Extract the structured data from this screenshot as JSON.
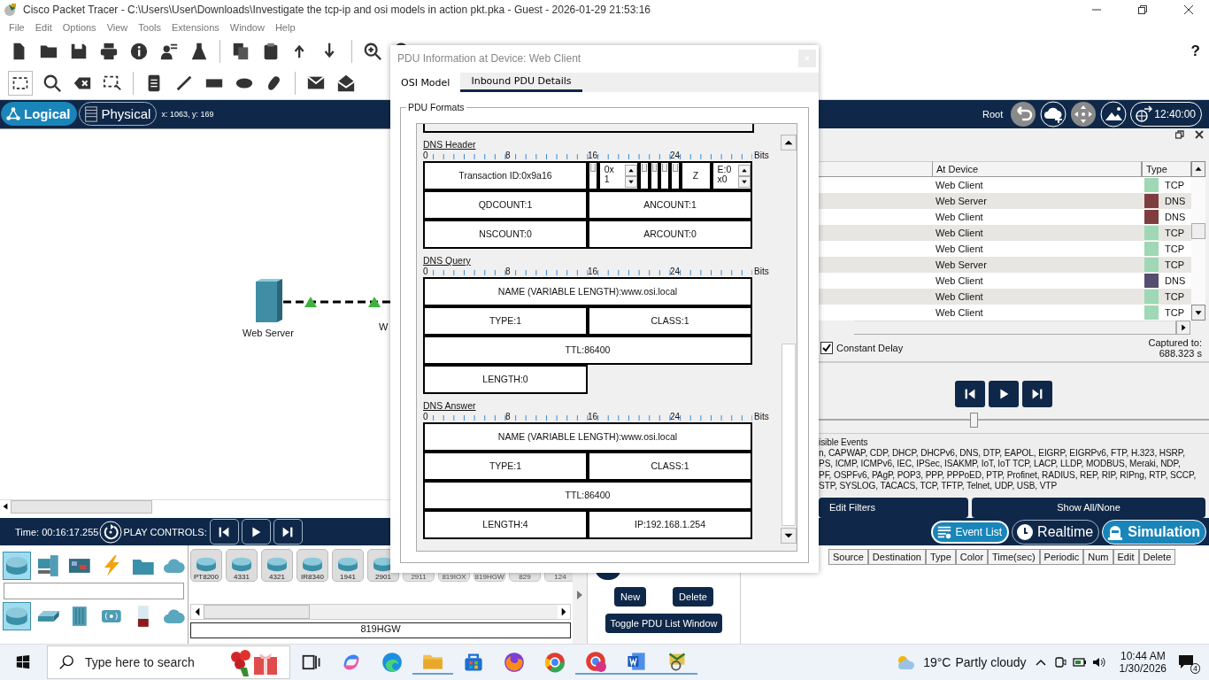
{
  "window": {
    "title": "Cisco Packet Tracer - C:\\Users\\User\\Downloads\\Investigate the tcp-ip and osi models in action pkt.pka - Guest - 2026-01-29 21:53:16"
  },
  "menu": [
    "File",
    "Edit",
    "Options",
    "View",
    "Tools",
    "Extensions",
    "Window",
    "Help"
  ],
  "toolbar": {
    "help": "?"
  },
  "nav": {
    "tabs": [
      {
        "label": "Logical",
        "selected": true
      },
      {
        "label": "Physical",
        "selected": false
      }
    ],
    "coordinates": "x: 1063, y: 169",
    "root": "Root",
    "clock": "12:40:00"
  },
  "workspace": {
    "device": "Web Server",
    "cut_label": "W"
  },
  "event_list": {
    "columns": [
      "At Device",
      "Type"
    ],
    "rows": [
      {
        "at_device": "Web Client",
        "type": "TCP",
        "color": "#9ed8b4"
      },
      {
        "at_device": "Web Server",
        "type": "DNS",
        "color": "#7f3d3f"
      },
      {
        "at_device": "Web Client",
        "type": "DNS",
        "color": "#7f3d3f"
      },
      {
        "at_device": "Web Client",
        "type": "TCP",
        "color": "#9ed8b4"
      },
      {
        "at_device": "Web Client",
        "type": "TCP",
        "color": "#9ed8b4"
      },
      {
        "at_device": "Web Server",
        "type": "TCP",
        "color": "#9ed8b4"
      },
      {
        "at_device": "Web Client",
        "type": "DNS",
        "color": "#554e6e"
      },
      {
        "at_device": "Web Client",
        "type": "TCP",
        "color": "#9ed8b4"
      },
      {
        "at_device": "Web Client",
        "type": "TCP",
        "color": "#9ed8b4"
      }
    ]
  },
  "constant_delay": {
    "label": "Constant Delay",
    "checked": true
  },
  "captured": {
    "label": "Captured to:",
    "value": "688.323 s"
  },
  "speed": {
    "level": 0.4
  },
  "visible_events": {
    "title": "isible Events",
    "lines": [
      "n, CAPWAP, CDP, DHCP, DHCPv6, DNS, DTP, EAPOL, EIGRP, EIGRPv6, FTP, H.323, HSRP,",
      "PS, ICMP, ICMPv6, IEC, IPSec, ISAKMP, IoT, IoT TCP, LACP, LLDP, MODBUS, Meraki, NDP,",
      "PF, OSPFv6, PAgP, POP3, PPP, PPPoED, PTP, Profinet, RADIUS, REP, RIP, RIPng, RTP, SCCP,",
      "STP, SYSLOG, TACACS, TCP, TFTP, Telnet, UDP, USB, VTP"
    ]
  },
  "filter_buttons": [
    "Edit Filters",
    "Show All/None"
  ],
  "bottom_bar": {
    "time": "Time: 00:16:17.255",
    "play_label": "PLAY CONTROLS:",
    "event_list_button": "Event List",
    "modes": [
      {
        "label": "Realtime",
        "selected": false
      },
      {
        "label": "Simulation",
        "selected": true
      }
    ]
  },
  "device_panel": {
    "categories": [
      {
        "selected": true
      },
      {
        "selected": false
      },
      {
        "selected": false
      },
      {
        "selected": false
      },
      {
        "selected": false
      },
      {
        "selected": false
      }
    ],
    "subcategories": [
      {
        "selected": true
      },
      {
        "selected": false
      },
      {
        "selected": false
      },
      {
        "selected": false
      },
      {
        "selected": false
      },
      {
        "selected": false
      }
    ],
    "devices": [
      {
        "label": "PT8200",
        "disabled": false
      },
      {
        "label": "4331",
        "disabled": false
      },
      {
        "label": "4321",
        "disabled": false
      },
      {
        "label": "IR8340",
        "disabled": false
      },
      {
        "label": "1941",
        "disabled": false
      },
      {
        "label": "2901",
        "disabled": false
      },
      {
        "label": "2911",
        "disabled": true
      },
      {
        "label": "819IOX",
        "disabled": true
      },
      {
        "label": "819HGW",
        "disabled": true
      },
      {
        "label": "829",
        "disabled": true
      },
      {
        "label": "124",
        "disabled": true
      }
    ],
    "selected_device": "819HGW"
  },
  "pdu_panel": {
    "buttons": [
      "New",
      "Delete",
      "Toggle PDU List Window"
    ]
  },
  "pdu_list": {
    "columns": [
      "Source",
      "Destination",
      "Type",
      "Color",
      "Time(sec)",
      "Periodic",
      "Num",
      "Edit",
      "Delete"
    ]
  },
  "dialog": {
    "title": "PDU Information at Device: Web Client",
    "tabs": [
      {
        "label": "OSI Model",
        "selected": false
      },
      {
        "label": "Inbound PDU Details",
        "selected": true
      }
    ],
    "group": "PDU Formats",
    "sections": [
      {
        "title": "DNS Header",
        "ruler": [
          "0",
          "8",
          "16",
          "24"
        ],
        "unit": "Bits",
        "rows": [
          [
            {
              "kind": "half",
              "text": "Transaction ID:0x9a16"
            },
            {
              "kind": "bit"
            },
            {
              "kind": "spin",
              "lines": [
                "0x",
                "1"
              ]
            },
            {
              "kind": "bit"
            },
            {
              "kind": "bit"
            },
            {
              "kind": "bit"
            },
            {
              "kind": "bit"
            },
            {
              "kind": "triple",
              "text": "Z"
            },
            {
              "kind": "spin",
              "lines": [
                "E:0",
                "x0"
              ]
            }
          ],
          [
            {
              "kind": "half",
              "text": "QDCOUNT:1"
            },
            {
              "kind": "half",
              "text": "ANCOUNT:1"
            }
          ],
          [
            {
              "kind": "half",
              "text": "NSCOUNT:0"
            },
            {
              "kind": "half",
              "text": "ARCOUNT:0"
            }
          ]
        ]
      },
      {
        "title": "DNS Query",
        "ruler": [
          "0",
          "8",
          "16",
          "24"
        ],
        "unit": "Bits",
        "rows": [
          [
            {
              "kind": "full",
              "text": "NAME (VARIABLE LENGTH):www.osi.local"
            }
          ],
          [
            {
              "kind": "half",
              "text": "TYPE:1"
            },
            {
              "kind": "half",
              "text": "CLASS:1"
            }
          ],
          [
            {
              "kind": "full",
              "text": "TTL:86400"
            }
          ],
          [
            {
              "kind": "half",
              "text": "LENGTH:0"
            }
          ]
        ]
      },
      {
        "title": "DNS Answer",
        "ruler": [
          "0",
          "8",
          "16",
          "24"
        ],
        "unit": "Bits",
        "rows": [
          [
            {
              "kind": "full",
              "text": "NAME (VARIABLE LENGTH):www.osi.local"
            }
          ],
          [
            {
              "kind": "half",
              "text": "TYPE:1"
            },
            {
              "kind": "half",
              "text": "CLASS:1"
            }
          ],
          [
            {
              "kind": "full",
              "text": "TTL:86400"
            }
          ],
          [
            {
              "kind": "half",
              "text": "LENGTH:4"
            },
            {
              "kind": "half",
              "text": "IP:192.168.1.254"
            }
          ]
        ]
      }
    ]
  },
  "taskbar": {
    "search": "Type here to search",
    "temperature": "19°C",
    "condition": "Partly cloudy",
    "time": "10:44 AM",
    "date": "1/30/2026",
    "notifications": "4"
  }
}
